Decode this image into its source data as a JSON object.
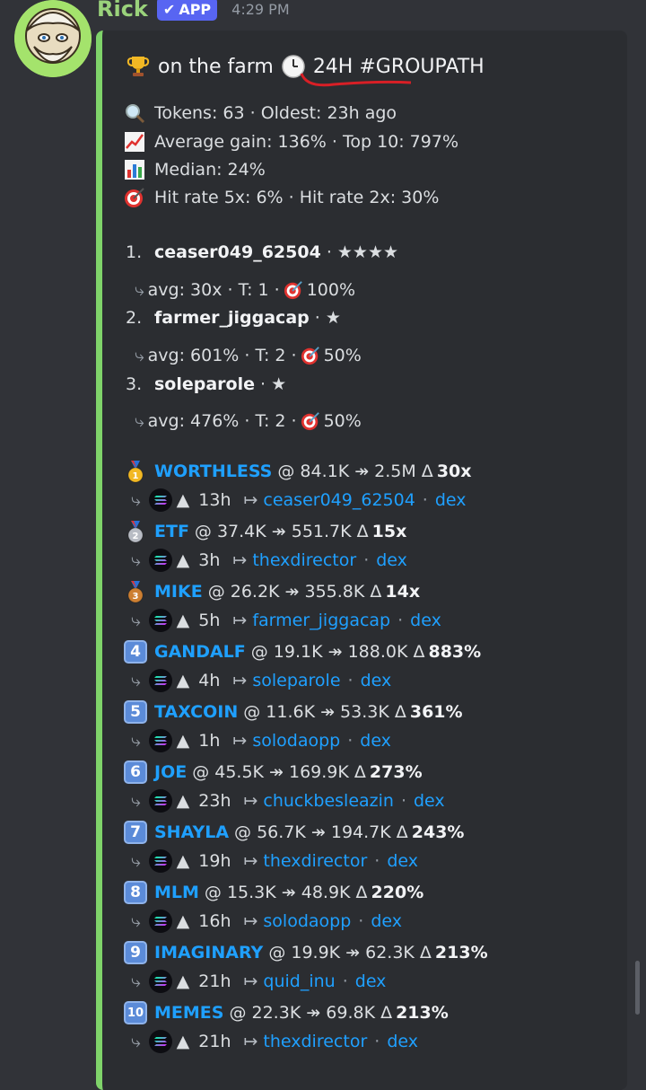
{
  "message": {
    "username": "Rick",
    "badge": "APP",
    "timestamp": "4:29 PM"
  },
  "embed": {
    "title_text": "on the farm",
    "title_tag": "24H #GROUPATH",
    "stats": [
      {
        "icon": "magnifier-icon",
        "text": "Tokens: 63 · Oldest: 23h ago"
      },
      {
        "icon": "chart-up-icon",
        "text": "Average gain: 136% · Top 10: 797%"
      },
      {
        "icon": "bar-chart-icon",
        "text": "Median: 24%"
      },
      {
        "icon": "target-icon",
        "text": "Hit rate 5x: 6% · Hit rate 2x: 30%"
      }
    ],
    "rankings": [
      {
        "num": "1.",
        "name": "ceaser049_62504",
        "stars": "· ★★★★",
        "avg": "avg: 30x · T: 1 ·",
        "hit": "100%"
      },
      {
        "num": "2.",
        "name": "farmer_jiggacap",
        "stars": "· ★",
        "avg": "avg: 601% · T: 2 ·",
        "hit": "50%"
      },
      {
        "num": "3.",
        "name": "soleparole",
        "stars": "· ★",
        "avg": "avg: 476% · T: 2 ·",
        "hit": "50%"
      }
    ],
    "tokens": [
      {
        "rank": "1",
        "name": "WORTHLESS",
        "prices": "@ 84.1K ↠ 2.5M Δ",
        "mult": "30x",
        "age": "13h",
        "caller": "ceaser049_62504",
        "dex": "dex"
      },
      {
        "rank": "2",
        "name": "ETF",
        "prices": "@ 37.4K ↠ 551.7K Δ",
        "mult": "15x",
        "age": "3h",
        "caller": "thexdirector",
        "dex": "dex"
      },
      {
        "rank": "3",
        "name": "MIKE",
        "prices": "@ 26.2K ↠ 355.8K Δ",
        "mult": "14x",
        "age": "5h",
        "caller": "farmer_jiggacap",
        "dex": "dex"
      },
      {
        "rank": "4",
        "name": "GANDALF",
        "prices": "@ 19.1K ↠ 188.0K Δ",
        "mult": "883%",
        "age": "4h",
        "caller": "soleparole",
        "dex": "dex"
      },
      {
        "rank": "5",
        "name": "TAXCOIN",
        "prices": "@ 11.6K ↠ 53.3K Δ",
        "mult": "361%",
        "age": "1h",
        "caller": "solodaopp",
        "dex": "dex"
      },
      {
        "rank": "6",
        "name": "JOE",
        "prices": "@ 45.5K ↠ 169.9K Δ",
        "mult": "273%",
        "age": "23h",
        "caller": "chuckbesleazin",
        "dex": "dex"
      },
      {
        "rank": "7",
        "name": "SHAYLA",
        "prices": "@ 56.7K ↠ 194.7K Δ",
        "mult": "243%",
        "age": "19h",
        "caller": "thexdirector",
        "dex": "dex"
      },
      {
        "rank": "8",
        "name": "MLM",
        "prices": "@ 15.3K ↠ 48.9K Δ",
        "mult": "220%",
        "age": "16h",
        "caller": "solodaopp",
        "dex": "dex"
      },
      {
        "rank": "9",
        "name": "IMAGINARY",
        "prices": "@ 19.9K ↠ 62.3K Δ",
        "mult": "213%",
        "age": "21h",
        "caller": "quid_inu",
        "dex": "dex"
      },
      {
        "rank": "10",
        "name": "MEMES",
        "prices": "@ 22.3K ↠ 69.8K Δ",
        "mult": "213%",
        "age": "21h",
        "caller": "thexdirector",
        "dex": "dex"
      }
    ]
  },
  "colors": {
    "background": "#313338",
    "embed_bg": "#2b2d31",
    "embed_accent": "#7fd36a",
    "link": "#1fa0ff",
    "badge": "#5865f2",
    "username": "#9ad27b"
  }
}
